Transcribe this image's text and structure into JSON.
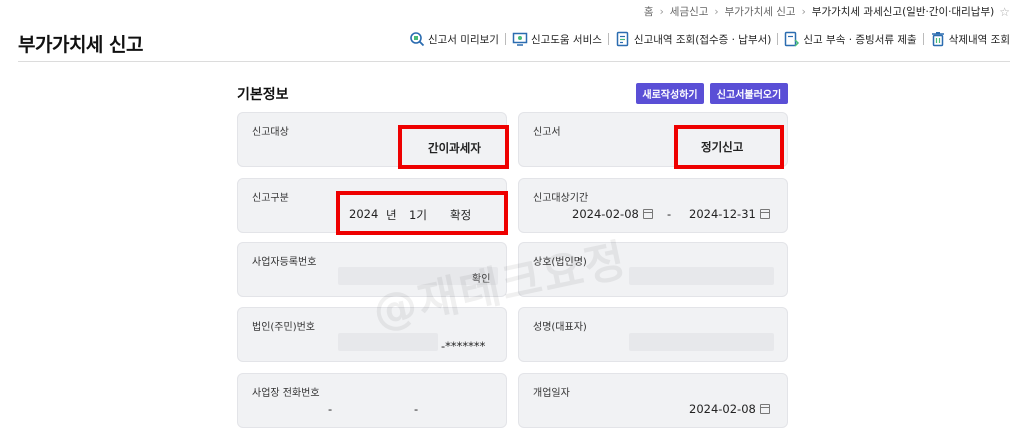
{
  "breadcrumb": {
    "items": [
      "홈",
      "세금신고",
      "부가가치세 신고"
    ],
    "current": "부가가치세 과세신고(일반·간이·대리납부)"
  },
  "header": {
    "title": "부가가치세 신고"
  },
  "toolbar": {
    "preview": "신고서 미리보기",
    "help": "신고도움 서비스",
    "history": "신고내역 조회(접수증 · 납부서)",
    "attach": "신고 부속 · 증빙서류 제출",
    "deleted": "삭제내역 조회"
  },
  "section": {
    "title": "기본정보",
    "new_button": "새로작성하기",
    "load_button": "신고서불러오기"
  },
  "fields": {
    "target": {
      "label": "신고대상",
      "value": "간이과세자"
    },
    "form": {
      "label": "신고서",
      "value": "정기신고"
    },
    "category": {
      "label": "신고구분",
      "year": "2024",
      "year_unit": "년",
      "period": "1기",
      "type": "확정"
    },
    "period": {
      "label": "신고대상기간",
      "start": "2024-02-08",
      "dash": "-",
      "end": "2024-12-31"
    },
    "bizno": {
      "label": "사업자등록번호",
      "confirm": "확인"
    },
    "company": {
      "label": "상호(법인명)"
    },
    "corpno": {
      "label": "법인(주민)번호",
      "masked": "-*******"
    },
    "name": {
      "label": "성명(대표자)"
    },
    "phone": {
      "label": "사업장 전화번호",
      "dash1": "-",
      "dash2": "-"
    },
    "opendate": {
      "label": "개업일자",
      "value": "2024-02-08"
    }
  },
  "watermark": "@재테크요정",
  "colors": {
    "accent": "#5a4fd6",
    "highlight": "#ee0000",
    "card": "#f1f2f4"
  },
  "icons": [
    "magnifier-doc-icon",
    "monitor-icon",
    "document-list-icon",
    "document-upload-icon",
    "trash-icon",
    "star-icon",
    "calendar-icon"
  ]
}
